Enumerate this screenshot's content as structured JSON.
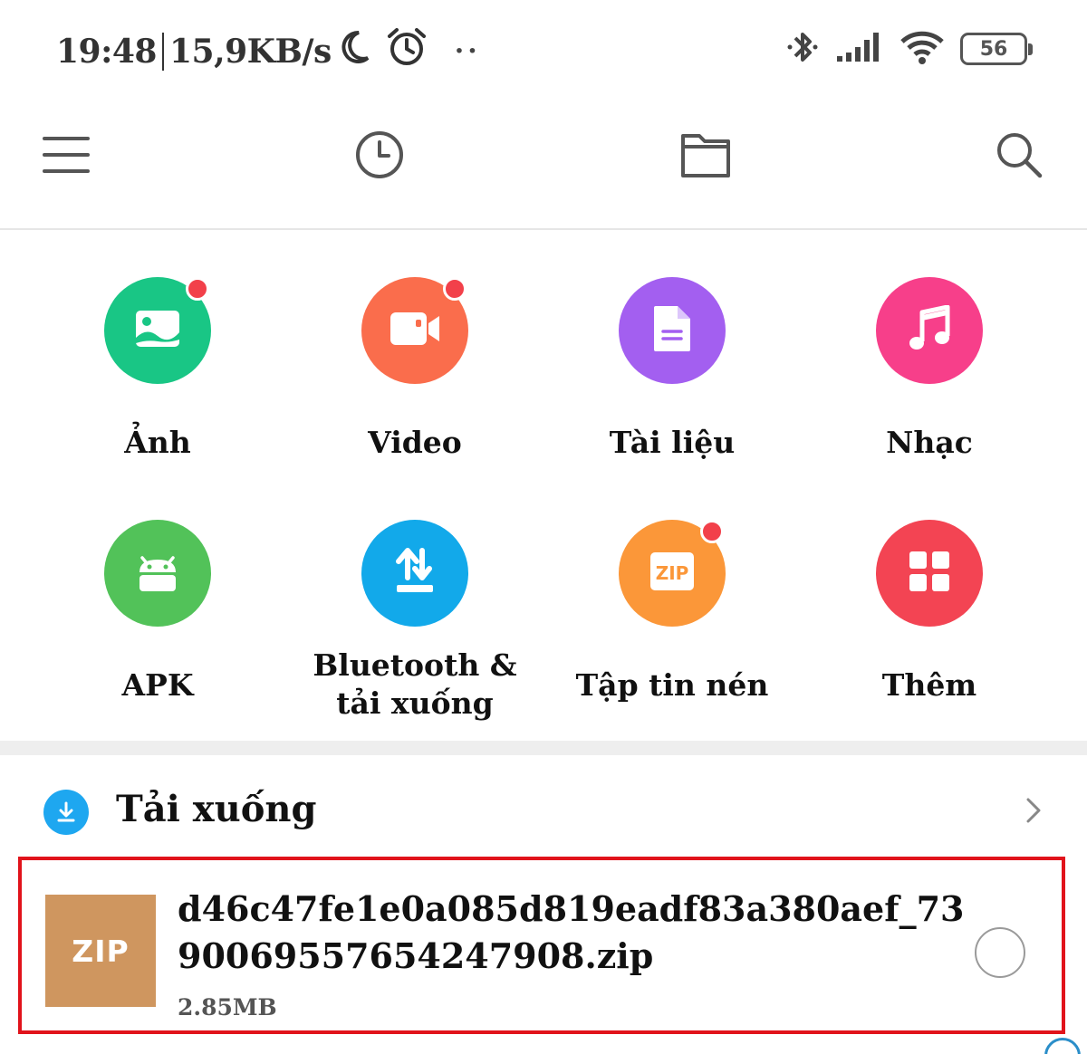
{
  "status_bar": {
    "time": "19:48",
    "net_speed": "15,9KB/s",
    "more": "··",
    "battery": "56"
  },
  "toolbar": {
    "icons": [
      "menu-icon",
      "clock-icon",
      "folder-icon",
      "search-icon"
    ]
  },
  "categories": [
    {
      "label": "Ảnh",
      "color": "#19c685",
      "icon": "image-icon",
      "badge": true
    },
    {
      "label": "Video",
      "color": "#fa6d4c",
      "icon": "video-camera-icon",
      "badge": true
    },
    {
      "label": "Tài liệu",
      "color": "#a35ff0",
      "icon": "document-icon",
      "badge": false
    },
    {
      "label": "Nhạc",
      "color": "#f73f8a",
      "icon": "music-note-icon",
      "badge": false
    },
    {
      "label": "APK",
      "color": "#52c259",
      "icon": "android-icon",
      "badge": false
    },
    {
      "label": "Bluetooth &\ntải xuống",
      "color": "#12a9ea",
      "icon": "transfer-arrows-icon",
      "badge": false
    },
    {
      "label": "Tập tin nén",
      "color": "#fb9739",
      "icon": "zip-icon",
      "badge": true
    },
    {
      "label": "Thêm",
      "color": "#f34453",
      "icon": "grid-icon",
      "badge": false
    }
  ],
  "downloads": {
    "title": "Tải xuống",
    "file": {
      "thumb_label": "ZIP",
      "name": "d46c47fe1e0a085d819eadf83a380aef_7390069557654247908.zip",
      "size": "2.85MB"
    }
  },
  "colors": {
    "highlight_border": "#e1131b",
    "zip_thumb": "#cf965f",
    "download_icon": "#1ea7f0"
  }
}
